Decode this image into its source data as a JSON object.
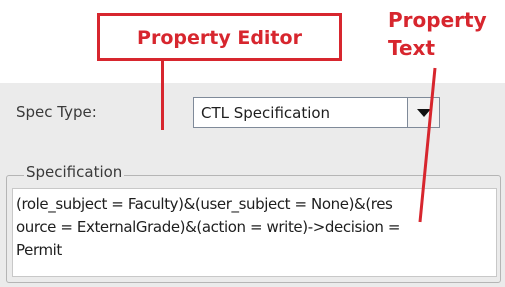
{
  "annotations": {
    "property_editor": "Property Editor",
    "property_text_line1": "Property",
    "property_text_line2": "Text",
    "accent_color": "#d7262e"
  },
  "form": {
    "spec_type_label": "Spec Type:",
    "spec_type_value": "CTL Specification",
    "dropdown_icon": "chevron-down-icon",
    "specification_group_title": "Specification",
    "specification_lines": [
      "(role_subject = Faculty)&(user_subject = None)&(res",
      "ource = ExternalGrade)&(action = write)->decision =",
      "Permit"
    ]
  }
}
